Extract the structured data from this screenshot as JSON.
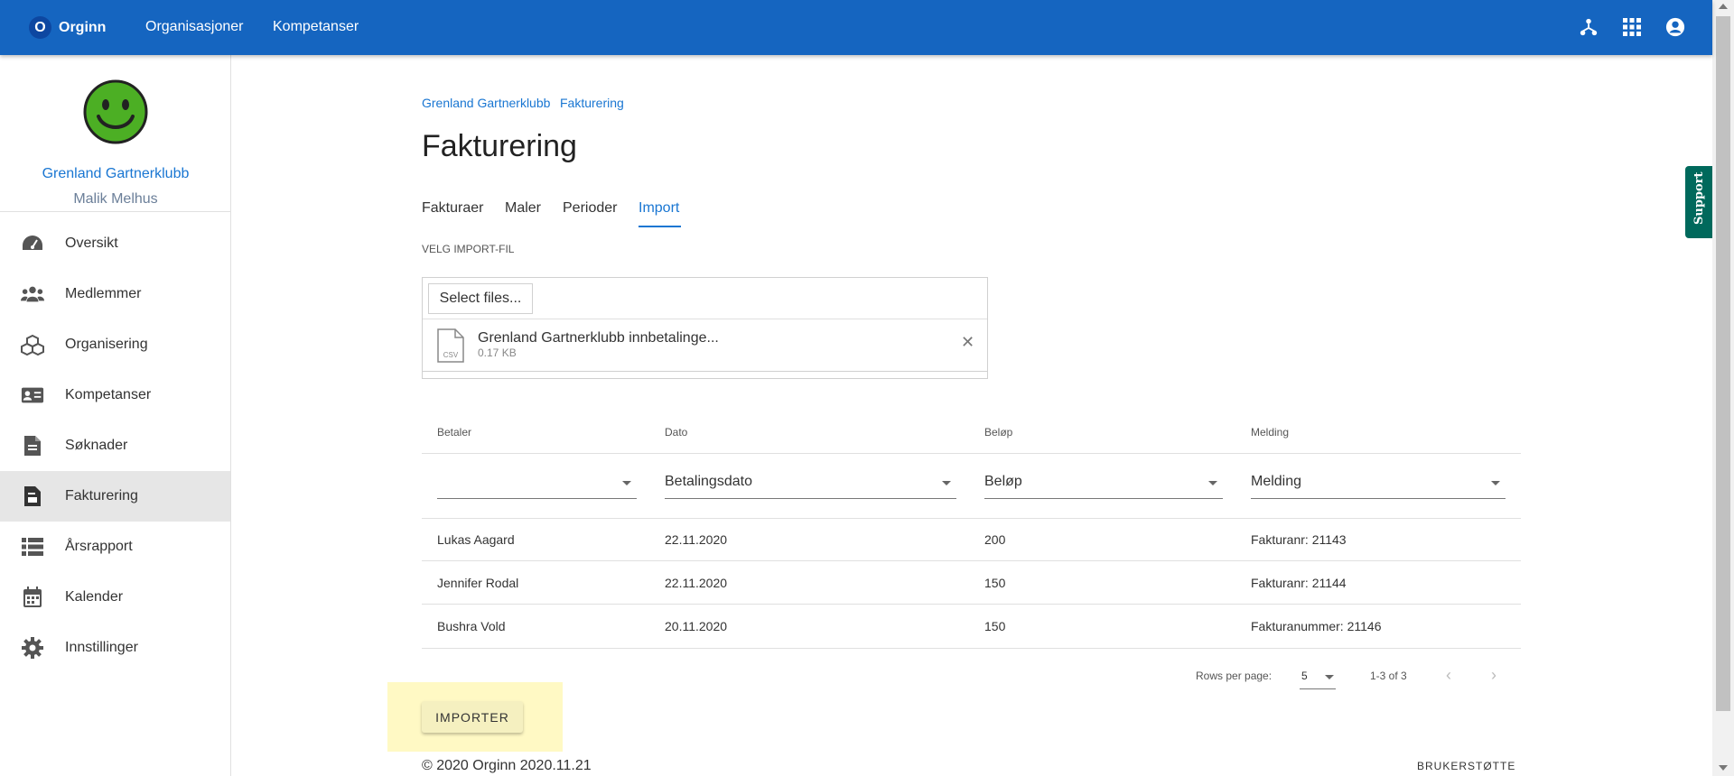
{
  "topbar": {
    "logo_letter": "O",
    "brand": "Orginn",
    "nav": [
      "Organisasjoner",
      "Kompetanser"
    ],
    "icons": [
      "hierarchy-icon",
      "apps-grid-icon",
      "account-circle-icon"
    ],
    "color": "#1565c0"
  },
  "sidebar": {
    "org_name": "Grenland Gartnerklubb",
    "user_name": "Malik Melhus",
    "items": [
      {
        "label": "Oversikt",
        "icon": "speedometer-icon"
      },
      {
        "label": "Medlemmer",
        "icon": "people-icon"
      },
      {
        "label": "Organisering",
        "icon": "cubes-icon"
      },
      {
        "label": "Kompetanser",
        "icon": "id-card-icon"
      },
      {
        "label": "Søknader",
        "icon": "document-icon"
      },
      {
        "label": "Fakturering",
        "icon": "invoice-icon",
        "active": true
      },
      {
        "label": "Årsrapport",
        "icon": "list-icon"
      },
      {
        "label": "Kalender",
        "icon": "calendar-icon"
      },
      {
        "label": "Innstillinger",
        "icon": "gear-icon"
      }
    ]
  },
  "breadcrumb": [
    "Grenland Gartnerklubb",
    "Fakturering"
  ],
  "page_title": "Fakturering",
  "tabs": [
    {
      "label": "Fakturaer"
    },
    {
      "label": "Maler"
    },
    {
      "label": "Perioder"
    },
    {
      "label": "Import",
      "active": true
    }
  ],
  "import": {
    "section_label": "VELG IMPORT-FIL",
    "select_button": "Select files...",
    "file": {
      "name": "Grenland Gartnerklubb innbetalinge...",
      "size": "0.17 KB",
      "type_label": "CSV"
    }
  },
  "table": {
    "columns": [
      "Betaler",
      "Dato",
      "Beløp",
      "Melding"
    ],
    "mapping": [
      "",
      "Betalingsdato",
      "Beløp",
      "Melding"
    ],
    "rows": [
      [
        "Lukas Aagard",
        "22.11.2020",
        "200",
        "Fakturanr: 21143"
      ],
      [
        "Jennifer Rodal",
        "22.11.2020",
        "150",
        "Fakturanr: 21144"
      ],
      [
        "Bushra Vold",
        "20.11.2020",
        "150",
        "Fakturanummer: 21146"
      ]
    ]
  },
  "pager": {
    "rows_per_page_label": "Rows per page:",
    "rows_per_page": "5",
    "range": "1-3 of 3"
  },
  "import_button": "IMPORTER",
  "footer": {
    "copyright": "© 2020 Orginn 2020.11.21",
    "support_link": "BRUKERSTØTTE"
  },
  "support_tab": "Support",
  "colors": {
    "accent": "#1976d2",
    "highlight": "#fff9c4",
    "support": "#00695c"
  }
}
